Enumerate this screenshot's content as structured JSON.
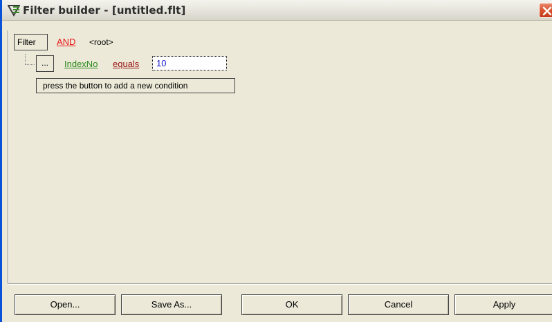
{
  "window": {
    "title": "Filter builder - [untitled.flt]",
    "icon": "filter-builder-app-icon",
    "close_icon": "close-icon"
  },
  "filter_tree": {
    "root_button_label": "Filter",
    "group_operator": "AND",
    "root_label": "<root>",
    "condition": {
      "menu_button_label": "...",
      "field": "IndexNo",
      "operator": "equals",
      "value": "10"
    },
    "hint": "press the button to add a new condition"
  },
  "buttons": {
    "open": "Open...",
    "save_as": "Save As...",
    "ok": "OK",
    "cancel": "Cancel",
    "apply": "Apply"
  },
  "colors": {
    "group_operator": "#e81616",
    "field": "#2a8a1a",
    "operator": "#9a1414",
    "value": "#1a1ad0"
  }
}
